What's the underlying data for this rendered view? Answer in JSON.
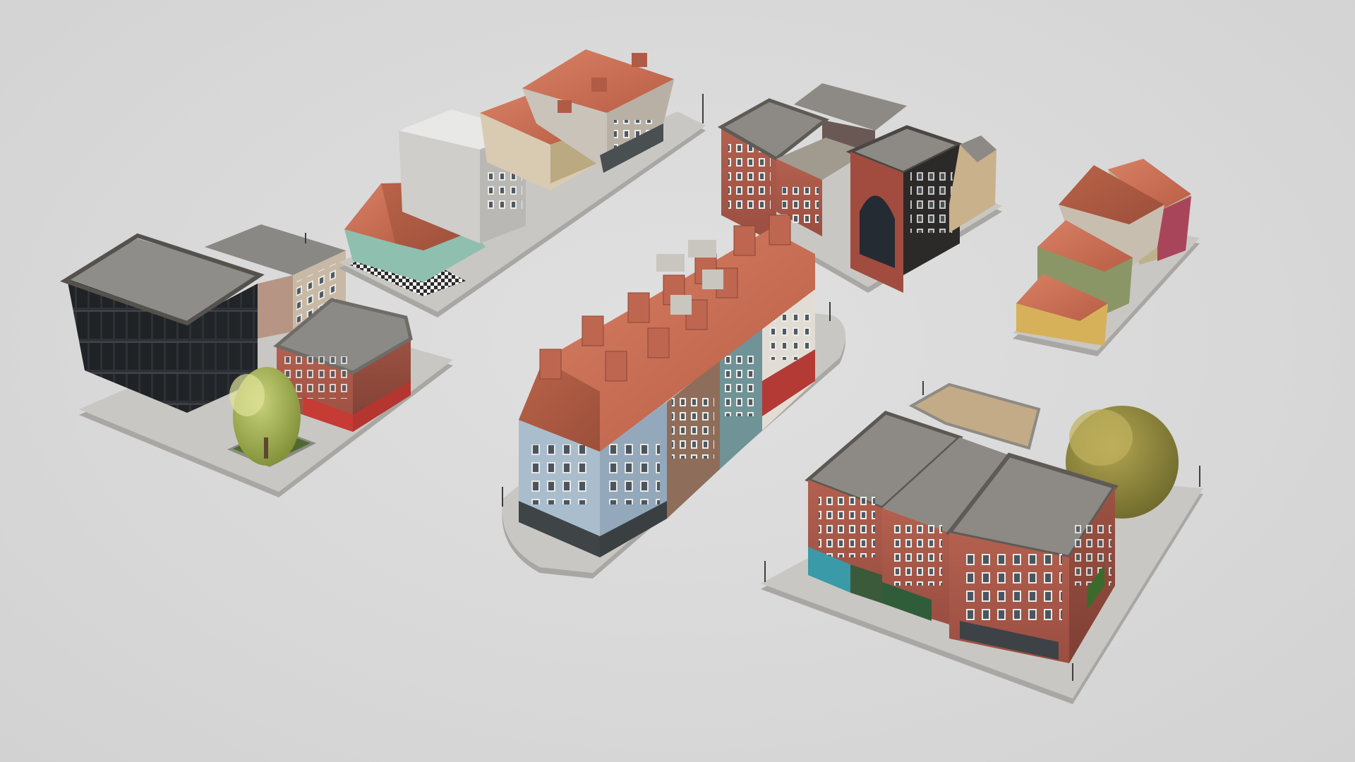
{
  "scene": {
    "subject": "3d-city-blocks",
    "background_color": "#d9d9d9",
    "blocks": [
      {
        "id": "office-corner-block",
        "icon": "office-building-icon"
      },
      {
        "id": "terraced-houses-row",
        "icon": "house-row-icon"
      },
      {
        "id": "brick-civic-block",
        "icon": "brick-building-icon"
      },
      {
        "id": "small-houses-block",
        "icon": "house-icon"
      },
      {
        "id": "curved-terrace-block",
        "icon": "terrace-icon"
      },
      {
        "id": "brick-corner-block",
        "icon": "corner-building-icon"
      }
    ],
    "colors": {
      "pavement": "#c9c7c3",
      "pavement_edge": "#a9a7a3",
      "roof_tile": "#c96e55",
      "roof_flat": "#8f8d89",
      "brick": "#a8574a",
      "glass": "#2a2d30",
      "tree": "#9fae4a"
    }
  }
}
